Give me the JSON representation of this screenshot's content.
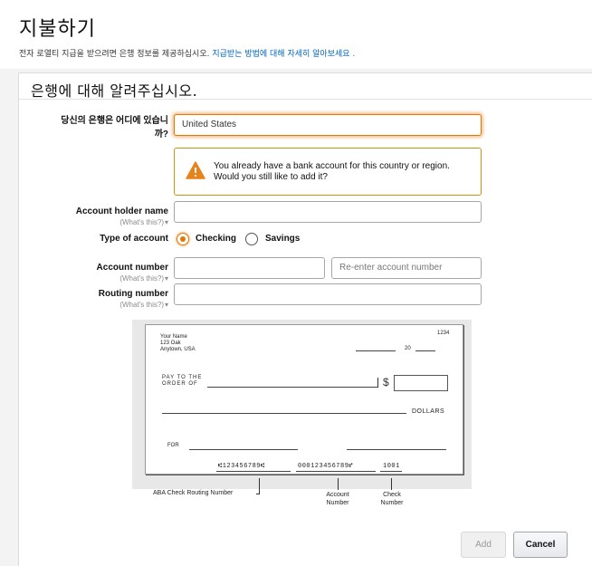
{
  "header": {
    "title": "지불하기",
    "subtitle_text": "전자 로열티 지급을 받으려면 은행 정보를 제공하십시오.",
    "subtitle_link": "지급받는 방법에 대해 자세히 알아보세요 ."
  },
  "form": {
    "section_title": "은행에 대해 알려주십시오.",
    "bank_location_label_line1": "당신의 은행은 어디에 있습니",
    "bank_location_label_line2": "까?",
    "bank_location_value": "United States",
    "alert_line1": "You already have a bank account for this country or region.",
    "alert_line2": "Would you still like to add it?",
    "account_holder_label": "Account holder name",
    "help_link": "(What's this?)",
    "account_type_label": "Type of account",
    "account_type_options": [
      "Checking",
      "Savings"
    ],
    "account_type_selected": "Checking",
    "account_number_label": "Account number",
    "reenter_placeholder": "Re-enter account number",
    "routing_number_label": "Routing number"
  },
  "check": {
    "name": "Your Name",
    "addr1": "123 Oak",
    "addr2": "Anytown, USA",
    "number": "1234",
    "date_prefix": "20",
    "pay_to_line1": "PAY TO THE",
    "pay_to_line2": "ORDER OF",
    "dollar_sign": "$",
    "dollars": "DOLLARS",
    "for": "FOR",
    "micr_routing": "⑆123456789⑆",
    "micr_account": "000123456789⑈",
    "micr_check": "1001",
    "caption_routing": "ABA Check Routing Number",
    "caption_account_line1": "Account",
    "caption_account_line2": "Number",
    "caption_check_line1": "Check",
    "caption_check_line2": "Number"
  },
  "buttons": {
    "add": "Add",
    "cancel": "Cancel"
  },
  "colors": {
    "accent": "#e77600",
    "link": "#0066c0",
    "alert_border": "#c89411"
  },
  "icons": [
    "warning-icon"
  ]
}
